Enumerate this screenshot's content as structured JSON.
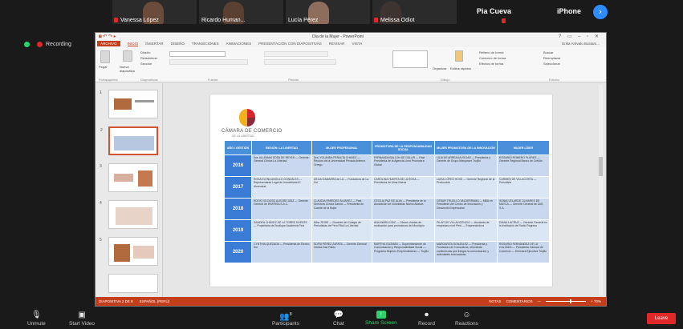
{
  "gallery": {
    "participants": [
      {
        "name": "Vanessa López"
      },
      {
        "name": "Ricardo Human..."
      },
      {
        "name": "Lucía Pérez"
      },
      {
        "name": "Melissa Odiot"
      }
    ],
    "name_only": [
      "Pia Cueva",
      "iPhone"
    ],
    "next_label": "›"
  },
  "recording": {
    "label": "Recording"
  },
  "ppt": {
    "window_title": "Día de la Mujer - PowerPoint",
    "qa_icons": "◙ ↶ ↷ ▸",
    "window_controls": "? ▭ – ▫ ✕",
    "tabs": [
      "ARCHIVO",
      "INICIO",
      "INSERTAR",
      "DISEÑO",
      "TRANSICIONES",
      "ANIMACIONES",
      "PRESENTACIÓN CON DIAPOSITIVAS",
      "REVISAR",
      "VISTA"
    ],
    "user": "Erika Arévalo Bustam...",
    "ribbon_groups": [
      "Portapapeles",
      "Diapositivas",
      "Fuente",
      "Párrafo",
      "Dibujo",
      "Edición"
    ],
    "ribbon_labels": {
      "paste": "Pegar",
      "new_slide": "Nueva diapositiva",
      "layout": "Diseño",
      "reset": "Restablecer",
      "section": "Sección",
      "arrange": "Organizar",
      "styles": "Estilos rápidos",
      "shape_fill": "Relleno de forma",
      "shape_outline": "Contorno de forma",
      "shape_effects": "Efectos de forma",
      "find": "Buscar",
      "replace": "Reemplazar",
      "select": "Seleccionar"
    },
    "thumb_numbers": [
      "1",
      "2",
      "3",
      "4",
      "5"
    ],
    "status_left": [
      "DIAPOSITIVA 2 DE 8",
      "ESPAÑOL (PERÚ)"
    ],
    "status_right": [
      "NOTAS",
      "COMENTARIOS",
      "—",
      "+ 70%"
    ]
  },
  "slide": {
    "brand": "CÁMARA DE COMERCIO",
    "brand_sub": "DE LA LIBERTAD",
    "headers": [
      "AÑO / GESTIÓN",
      "REGIÓN: LA LIBERTAD",
      "MUJER PROFESIONAL",
      "PROMOTORA DE LA RESPONSABILIDAD SOCIAL",
      "MUJER PROMOTORA DE LA INNOVACIÓN",
      "MUJER LÍDER"
    ],
    "rows": [
      {
        "year": "2016",
        "cells": [
          "Sra. ALLEMAN SOSA DE REYES — Gerente General Clínica La Libertad",
          "Dra. YOLANDA PERALTA CHAVEZ — Rectora de la Universidad Privada Antenor Orrego",
          "FERNANDA BALLON DE GALUR — Past Presidenta de la Agencia Lima Promotora Global",
          "LILIA DE ARREAGA ROJAS — Presidenta y Gerente de Grupo Manpower Trujillo",
          "ROSARIO ROMERO FLORES — Gerente Regional Banco de Crédito"
        ]
      },
      {
        "year": "2017",
        "cells": [
          "ROSA ELENA ANGULO GONZÁLES — Representante Legal de Inmobiliaria El Almendral",
          "DELIA GAMARRA de LA — Fundadora de La Sol",
          "CAROLINA HUERTA DE LA ROSA — Presidenta de Alma Nueva",
          "LUISA LÓPEZ HOSS — Gerente Regional de la Producción",
          "CARMEN DE VILLACORTA — Periodista"
        ]
      },
      {
        "year": "2018",
        "cells": [
          "ROCÍO VILDOSO ALEGRE DÍAZ — Gerente General de INVERSA S.A.C.",
          "CLAUDIA PAREDES ÁLVAREZ — Past Directora Clínica Sanna — Presidenta de Comité de la Mujer",
          "CECILIA PAZ DE ALVA — Presidenta de la Asociación de Voluntarias Nueva Alianza",
          "CÉSAR TRUJILLO VALDERRAMA — MBA en Presidente del Centro de Innovación y Desarrollo Empresarial",
          "SONIA VELARDE OLIVARES DE MAYCA — Gerente General de ZAS, S.A."
        ]
      },
      {
        "year": "2019",
        "cells": [
          "SANDRA CHÁVEZ DE LA TORRE DUENTE — Propietaria de Boutique Academia Fina",
          "Mtra. ROSE — Docente del Colegio de Periodistas de Perú Filial La Libertad",
          "ANA MARÍA DÍAZ — Ofrece charlas de motivación para promotoras del Municipio",
          "PILAR DE VILLAVICENCIO — Asociada de empresas en el Perú — Emprendedora",
          "DIANA LACRUZ — Gerente General en la Institución de Radio Rogreso"
        ]
      },
      {
        "year": "2020",
        "cells": [
          "CYNTHIA QUEZADA — Presidenta de Electro Sur",
          "SOFÍA PÉREZ ZAPATA — Gerente General Clínica San Pablo",
          "MARTHA GUZMÁN — Superintendente de Comunicación y Responsabilidad Social — Programa Mujeres Emprendedoras — Trujillo",
          "MARGARITA GONZÁLEZ — Presidenta y Fundadora de Consultoría, ofreciendo conferencias que integra la comunicación y actividades innovadoras",
          "ROSARIO FERNÁNDEZ DE LA CALZADA — Presidenta Cámara de Comercio — Directora Ejecutiva Trujillo"
        ]
      }
    ]
  },
  "toolbar": {
    "unmute": "Unmute",
    "start_video": "Start Video",
    "participants": "Participants",
    "participants_count": "8",
    "chat": "Chat",
    "share_screen": "Share Screen",
    "record": "Record",
    "reactions": "Reactions",
    "leave": "Leave"
  },
  "colors": {
    "zoom_bg": "#1a1a1a",
    "ppt_accent": "#c43e1c",
    "table_header": "#4a8fd9",
    "leave_red": "#e02828",
    "share_green": "#2bd46b"
  }
}
